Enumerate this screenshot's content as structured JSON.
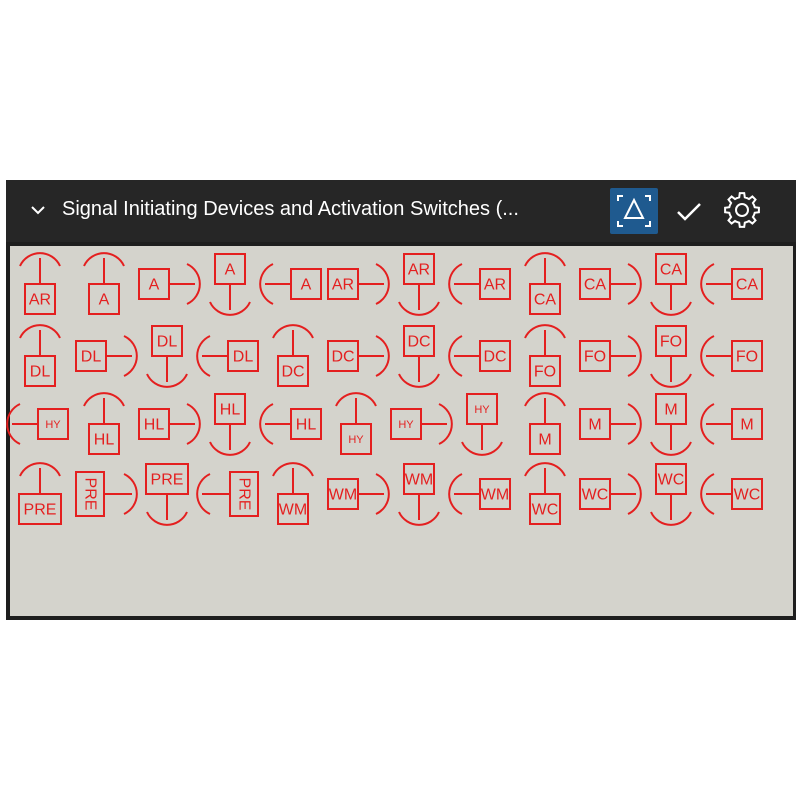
{
  "panel": {
    "title": "Signal Initiating Devices and Activation Switches (...",
    "icons": {
      "collapse": "chevron-down-icon",
      "mode": "expand-triangle-icon",
      "confirm": "checkmark-icon",
      "settings": "gear-icon"
    },
    "colors": {
      "header_bg": "#262626",
      "gallery_bg": "#d4d3cc",
      "symbol_red": "#e41f1f",
      "active_button": "#1f5a8f"
    }
  },
  "symbols": [
    {
      "label": "AR",
      "mount": "top"
    },
    {
      "label": "A",
      "mount": "top"
    },
    {
      "label": "A",
      "mount": "right"
    },
    {
      "label": "A",
      "mount": "bottom"
    },
    {
      "label": "A",
      "mount": "left"
    },
    {
      "label": "AR",
      "mount": "right"
    },
    {
      "label": "AR",
      "mount": "bottom"
    },
    {
      "label": "AR",
      "mount": "left"
    },
    {
      "label": "CA",
      "mount": "top"
    },
    {
      "label": "CA",
      "mount": "right"
    },
    {
      "label": "CA",
      "mount": "bottom"
    },
    {
      "label": "CA",
      "mount": "left"
    },
    {
      "label": "DL",
      "mount": "top"
    },
    {
      "label": "DL",
      "mount": "right"
    },
    {
      "label": "DL",
      "mount": "bottom"
    },
    {
      "label": "DL",
      "mount": "left"
    },
    {
      "label": "DC",
      "mount": "top"
    },
    {
      "label": "DC",
      "mount": "right"
    },
    {
      "label": "DC",
      "mount": "bottom"
    },
    {
      "label": "DC",
      "mount": "left"
    },
    {
      "label": "FO",
      "mount": "top"
    },
    {
      "label": "FO",
      "mount": "right"
    },
    {
      "label": "FO",
      "mount": "bottom"
    },
    {
      "label": "FO",
      "mount": "left"
    },
    {
      "label": "HY",
      "mount": "left"
    },
    {
      "label": "HL",
      "mount": "top"
    },
    {
      "label": "HL",
      "mount": "right"
    },
    {
      "label": "HL",
      "mount": "bottom"
    },
    {
      "label": "HL",
      "mount": "left"
    },
    {
      "label": "HY",
      "mount": "top"
    },
    {
      "label": "HY",
      "mount": "right"
    },
    {
      "label": "HY",
      "mount": "bottom"
    },
    {
      "label": "M",
      "mount": "top"
    },
    {
      "label": "M",
      "mount": "right"
    },
    {
      "label": "M",
      "mount": "bottom"
    },
    {
      "label": "M",
      "mount": "left"
    },
    {
      "label": "PRE",
      "mount": "top"
    },
    {
      "label": "PRE",
      "mount": "right",
      "vertical": true
    },
    {
      "label": "PRE",
      "mount": "bottom"
    },
    {
      "label": "PRE",
      "mount": "left",
      "vertical": true
    },
    {
      "label": "WM",
      "mount": "top"
    },
    {
      "label": "WM",
      "mount": "right"
    },
    {
      "label": "WM",
      "mount": "bottom"
    },
    {
      "label": "WM",
      "mount": "left"
    },
    {
      "label": "WC",
      "mount": "top"
    },
    {
      "label": "WC",
      "mount": "right"
    },
    {
      "label": "WC",
      "mount": "bottom"
    },
    {
      "label": "WC",
      "mount": "left"
    }
  ]
}
